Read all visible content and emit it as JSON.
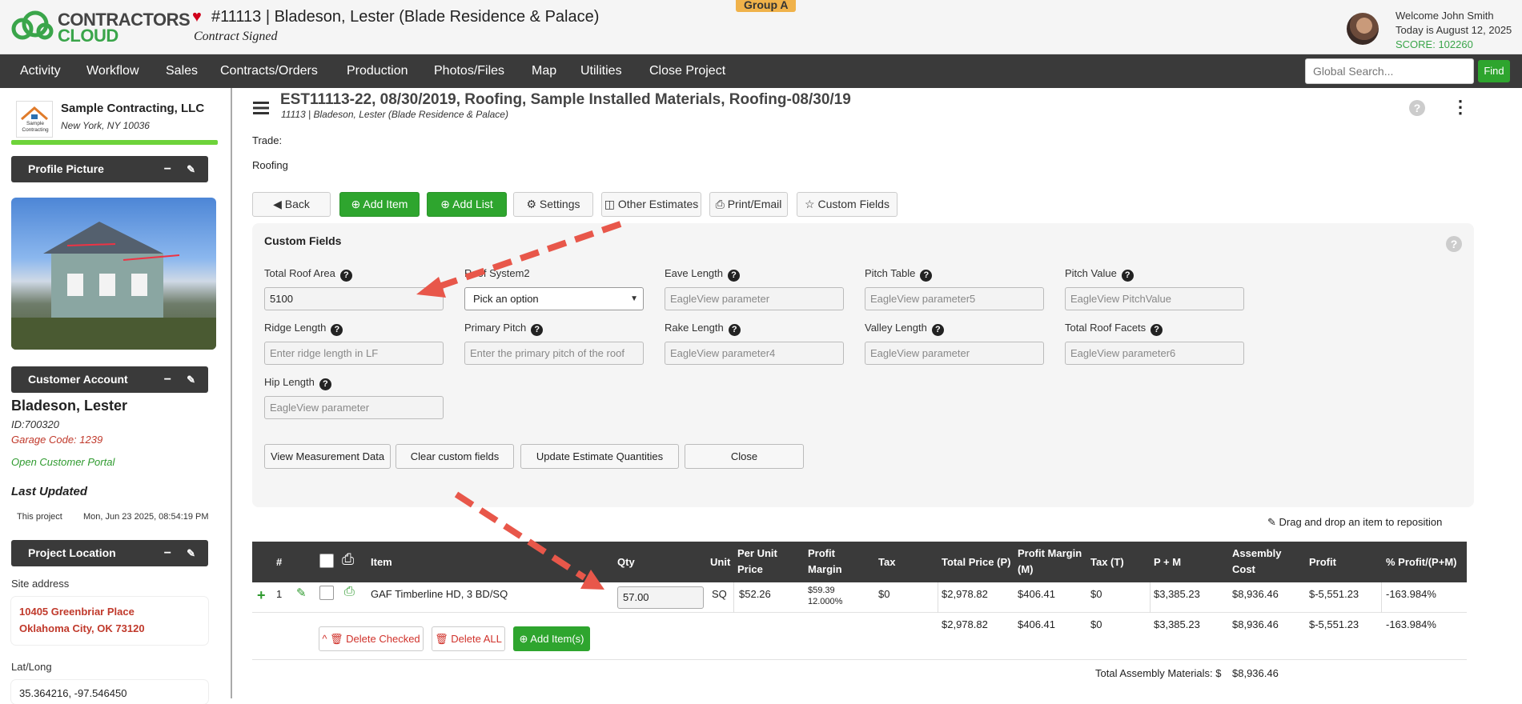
{
  "header": {
    "logo_line1": "CONTRACTORS",
    "logo_line2": "CLOUD",
    "project_title": "#11113 | Bladeson, Lester (Blade Residence & Palace)",
    "project_status": "Contract Signed",
    "group_badge": "Group A",
    "welcome": "Welcome John Smith",
    "today": "Today is August 12, 2025",
    "score": "SCORE: 102260"
  },
  "nav": {
    "items": [
      "Activity",
      "Workflow",
      "Sales",
      "Contracts/Orders",
      "Production",
      "Photos/Files",
      "Map",
      "Utilities",
      "Close Project"
    ],
    "search_placeholder": "Global Search...",
    "find_label": "Find"
  },
  "sidebar": {
    "company_name": "Sample Contracting, LLC",
    "company_location": "New York, NY 10036",
    "company_logo_text": "Sample Contracting",
    "profile_picture_label": "Profile Picture",
    "customer_account_label": "Customer Account",
    "customer_name": "Bladeson, Lester",
    "customer_id": "ID:700320",
    "garage_code": "Garage Code: 1239",
    "portal_link": "Open Customer Portal",
    "last_updated_label": "Last Updated",
    "this_project_label": "This project",
    "last_updated_value": "Mon, Jun 23 2025, 08:54:19 PM",
    "project_location_label": "Project Location",
    "site_address_label": "Site address",
    "address_line1": "10405 Greenbriar Place",
    "address_line2": "Oklahoma City, OK 73120",
    "latlong_label": "Lat/Long",
    "latlong_value": "35.364216, -97.546450"
  },
  "estimate": {
    "title": "EST11113-22, 08/30/2019, Roofing, Sample Installed Materials, Roofing-08/30/19",
    "subtitle": "11113 | Bladeson, Lester (Blade Residence & Palace)",
    "trade_label": "Trade:",
    "trade_value": "Roofing"
  },
  "toolbar": {
    "back": "Back",
    "add_item": "Add Item",
    "add_list": "Add List",
    "settings": "Settings",
    "other_estimates": "Other Estimates",
    "print_email": "Print/Email",
    "custom_fields": "Custom Fields"
  },
  "custom_fields": {
    "title": "Custom Fields",
    "total_roof_area_label": "Total Roof Area",
    "total_roof_area_value": "5100",
    "roof_system_label": "Roof System2",
    "roof_system_value": "Pick an option",
    "eave_length_label": "Eave Length",
    "eave_length_placeholder": "EagleView parameter",
    "pitch_table_label": "Pitch Table",
    "pitch_table_placeholder": "EagleView parameter5",
    "pitch_value_label": "Pitch Value",
    "pitch_value_placeholder": "EagleView PitchValue",
    "ridge_length_label": "Ridge Length",
    "ridge_length_placeholder": "Enter ridge length in LF",
    "primary_pitch_label": "Primary Pitch",
    "primary_pitch_placeholder": "Enter the primary pitch of the roof",
    "rake_length_label": "Rake Length",
    "rake_length_placeholder": "EagleView parameter4",
    "valley_length_label": "Valley Length",
    "valley_length_placeholder": "EagleView parameter",
    "total_roof_facets_label": "Total Roof Facets",
    "total_roof_facets_placeholder": "EagleView parameter6",
    "hip_length_label": "Hip Length",
    "hip_length_placeholder": "EagleView parameter",
    "view_measurement": "View Measurement Data",
    "clear_fields": "Clear custom fields",
    "update_quantities": "Update Estimate Quantities",
    "close": "Close"
  },
  "drag_hint": "Drag and drop an item to reposition",
  "table": {
    "headers": {
      "num": "#",
      "item": "Item",
      "qty": "Qty",
      "unit": "Unit",
      "per_unit_price": "Per Unit Price",
      "profit_margin": "Profit Margin",
      "tax": "Tax",
      "total_price": "Total Price (P)",
      "profit_margin_m": "Profit Margin (M)",
      "tax_t": "Tax (T)",
      "p_plus_m": "P + M",
      "assembly_cost": "Assembly Cost",
      "profit": "Profit",
      "pct_profit": "% Profit/(P+M)"
    },
    "row": {
      "num": "1",
      "item": "GAF Timberline HD, 3 BD/SQ",
      "qty": "57.00",
      "unit": "SQ",
      "per_unit_price": "$52.26",
      "profit_margin": "$59.39",
      "profit_margin_pct": "12.000%",
      "tax": "$0",
      "total_price": "$2,978.82",
      "profit_margin_m": "$406.41",
      "tax_t": "$0",
      "p_plus_m": "$3,385.23",
      "assembly_cost": "$8,936.46",
      "profit": "$-5,551.23",
      "pct_profit": "-163.984%"
    },
    "totals": {
      "total_price": "$2,978.82",
      "profit_margin_m": "$406.41",
      "tax_t": "$0",
      "p_plus_m": "$3,385.23",
      "assembly_cost": "$8,936.46",
      "profit": "$-5,551.23",
      "pct_profit": "-163.984%"
    },
    "delete_checked": "Delete Checked",
    "delete_all": "Delete ALL",
    "add_items": "Add Item(s)",
    "total_assembly_label": "Total Assembly Materials: $",
    "total_assembly_value": "$8,936.46"
  },
  "colors": {
    "brand_green": "#3aa54a",
    "nav_bg": "#3a3a3a",
    "button_green": "#2ea52e",
    "annotation_arrow": "#e8574a",
    "badge": "#f0b24a"
  }
}
